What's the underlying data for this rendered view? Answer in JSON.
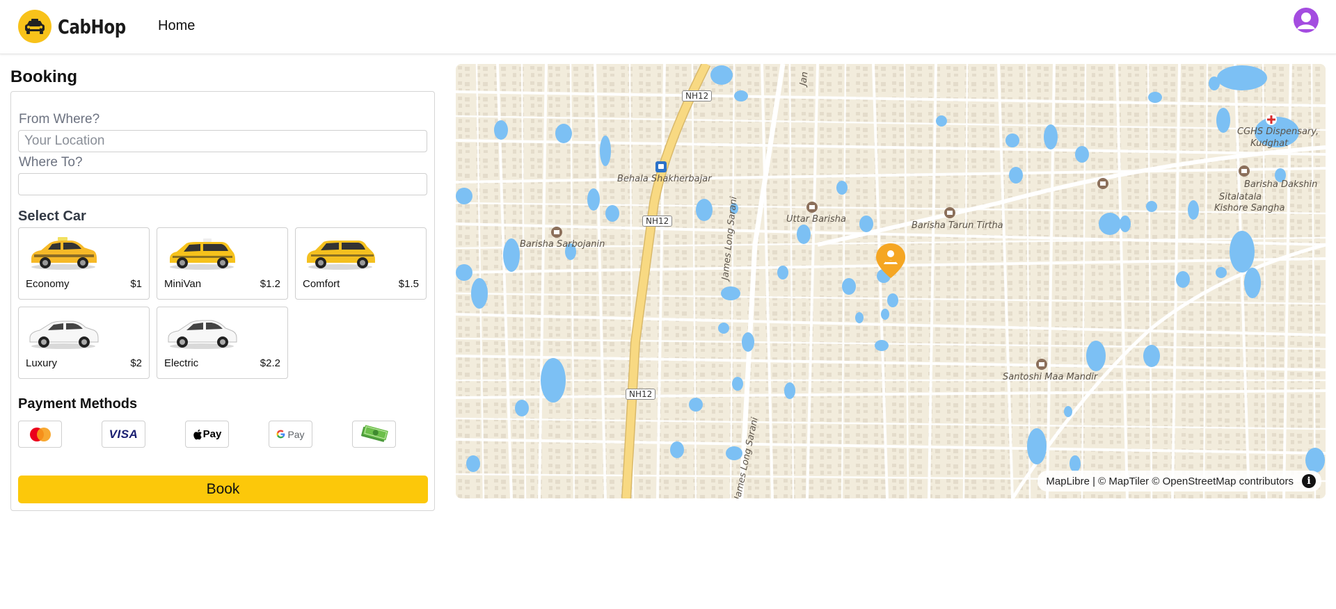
{
  "app": {
    "name": "CabHop"
  },
  "nav": {
    "home_label": "Home"
  },
  "booking": {
    "title": "Booking",
    "from_label": "From Where?",
    "from_placeholder": "Your Location",
    "from_value": "",
    "to_label": "Where To?",
    "to_value": "",
    "select_car_title": "Select Car",
    "cars": [
      {
        "name": "Economy",
        "price": "$1",
        "color": "#f6b928"
      },
      {
        "name": "MiniVan",
        "price": "$1.2",
        "color": "#f6c21c"
      },
      {
        "name": "Comfort",
        "price": "$1.5",
        "color": "#f4c020"
      },
      {
        "name": "Luxury",
        "price": "$2",
        "color": "#ffffff"
      },
      {
        "name": "Electric",
        "price": "$2.2",
        "color": "#ffffff"
      }
    ],
    "payment_title": "Payment Methods",
    "payment_methods": [
      "mastercard",
      "visa",
      "apple-pay",
      "google-pay",
      "cash"
    ],
    "visa_text": "VISA",
    "applepay_text": "Pay",
    "gpay_text": "Pay",
    "book_label": "Book"
  },
  "map": {
    "attribution": "MapLibre | © MapTiler © OpenStreetMap contributors",
    "info_glyph": "i",
    "labels": [
      "Behala Shakherbajar",
      "Barisha Sarbojanin",
      "Uttar Barisha",
      "Barisha Tarun Tirtha",
      "Sitalatala",
      "Kishore Sangha",
      "Barisha Dakshin",
      "CGHS Dispensary,",
      "Kudghat",
      "Santoshi Maa Mandir",
      "James Long Sarani",
      "James Long Sarani",
      "Jan"
    ],
    "road_shields": [
      "NH12",
      "NH12",
      "NH12"
    ],
    "colors": {
      "land": "#f2ecdc",
      "water": "#7cc0f4",
      "highway": "#f8d982",
      "street": "#ffffff",
      "pin": "#f5a623"
    }
  }
}
